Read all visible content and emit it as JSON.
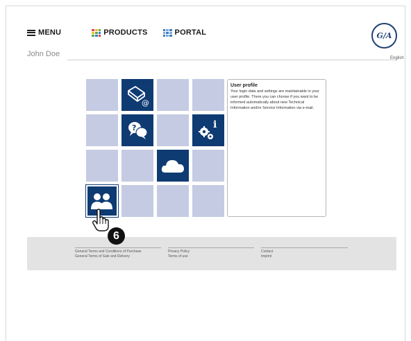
{
  "nav": {
    "menu_label": "MENU",
    "products_label": "PRODUCTS",
    "portal_label": "PORTAL",
    "products_icon_colors": [
      "#d64545",
      "#f0b73a",
      "#5aa84a",
      "#f0b73a",
      "#5aa84a",
      "#3b7fc4",
      "#5aa84a",
      "#3b7fc4",
      "#d64545"
    ],
    "portal_icon_colors": [
      "#3b7fc4",
      "#7aaad8",
      "#3b7fc4",
      "#7aaad8",
      "#3b7fc4",
      "#7aaad8",
      "#3b7fc4",
      "#7aaad8",
      "#3b7fc4"
    ]
  },
  "logo": {
    "text": "G/A"
  },
  "user": {
    "name": "John Doe"
  },
  "language": "English",
  "tiles": [
    {
      "icon": "",
      "interactable": false
    },
    {
      "icon": "book-email-icon",
      "interactable": true
    },
    {
      "icon": "",
      "interactable": false
    },
    {
      "icon": "",
      "interactable": false
    },
    {
      "icon": "",
      "interactable": false
    },
    {
      "icon": "faq-chat-icon",
      "interactable": true
    },
    {
      "icon": "",
      "interactable": false
    },
    {
      "icon": "settings-info-icon",
      "interactable": true
    },
    {
      "icon": "",
      "interactable": false
    },
    {
      "icon": "",
      "interactable": false
    },
    {
      "icon": "cloud-icon",
      "interactable": true
    },
    {
      "icon": "",
      "interactable": false
    },
    {
      "icon": "user-profile-icon",
      "interactable": true,
      "selected": true
    },
    {
      "icon": "",
      "interactable": false
    },
    {
      "icon": "",
      "interactable": false
    },
    {
      "icon": "",
      "interactable": false
    }
  ],
  "info": {
    "title": "User profile",
    "text": "Your login data and settings are maintainable in your user profile. There you can choose if you want to be informed automatically about new Technical Information and/or Service Information via e-mail."
  },
  "footer": {
    "col1": [
      "General Terms and Conditions of Purchase",
      "General Terms of Sale and Delivery"
    ],
    "col2": [
      "Privacy Policy",
      "Terms of use"
    ],
    "col3": [
      "Contact",
      "Imprint"
    ]
  },
  "step_number": "6",
  "colors": {
    "tile_light": "#c5cbe2",
    "tile_dark": "#0f3b73",
    "brand": "#1e3f73"
  }
}
